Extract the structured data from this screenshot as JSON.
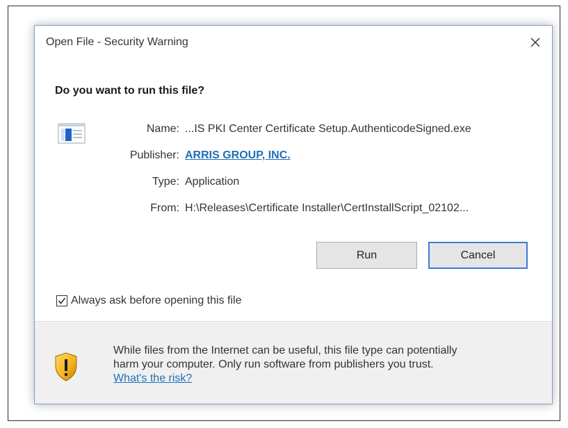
{
  "dialog": {
    "title": "Open File - Security Warning",
    "question": "Do you want to run this file?",
    "fields": {
      "name_label": "Name:",
      "name_value": "...IS PKI Center Certificate Setup.AuthenticodeSigned.exe",
      "publisher_label": "Publisher:",
      "publisher_value": "ARRIS GROUP, INC.",
      "type_label": "Type:",
      "type_value": "Application",
      "from_label": "From:",
      "from_value": "H:\\Releases\\Certificate Installer\\CertInstallScript_02102..."
    },
    "buttons": {
      "run": "Run",
      "cancel": "Cancel"
    },
    "checkbox": {
      "label": "Always ask before opening this file",
      "checked": true
    },
    "warning": {
      "line1": "While files from the Internet can be useful, this file type can potentially",
      "line2": "harm your computer. Only run software from publishers you trust.",
      "link": "What's the risk?"
    }
  },
  "icons": {
    "close": "close-icon",
    "app": "application-icon",
    "shield": "shield-warning-icon",
    "check": "checkmark-icon"
  },
  "colors": {
    "link": "#1f6fb5",
    "cancel_border": "#3a7bd5",
    "dialog_border": "#7a9cc4",
    "footer_bg": "#f0f0f0"
  }
}
